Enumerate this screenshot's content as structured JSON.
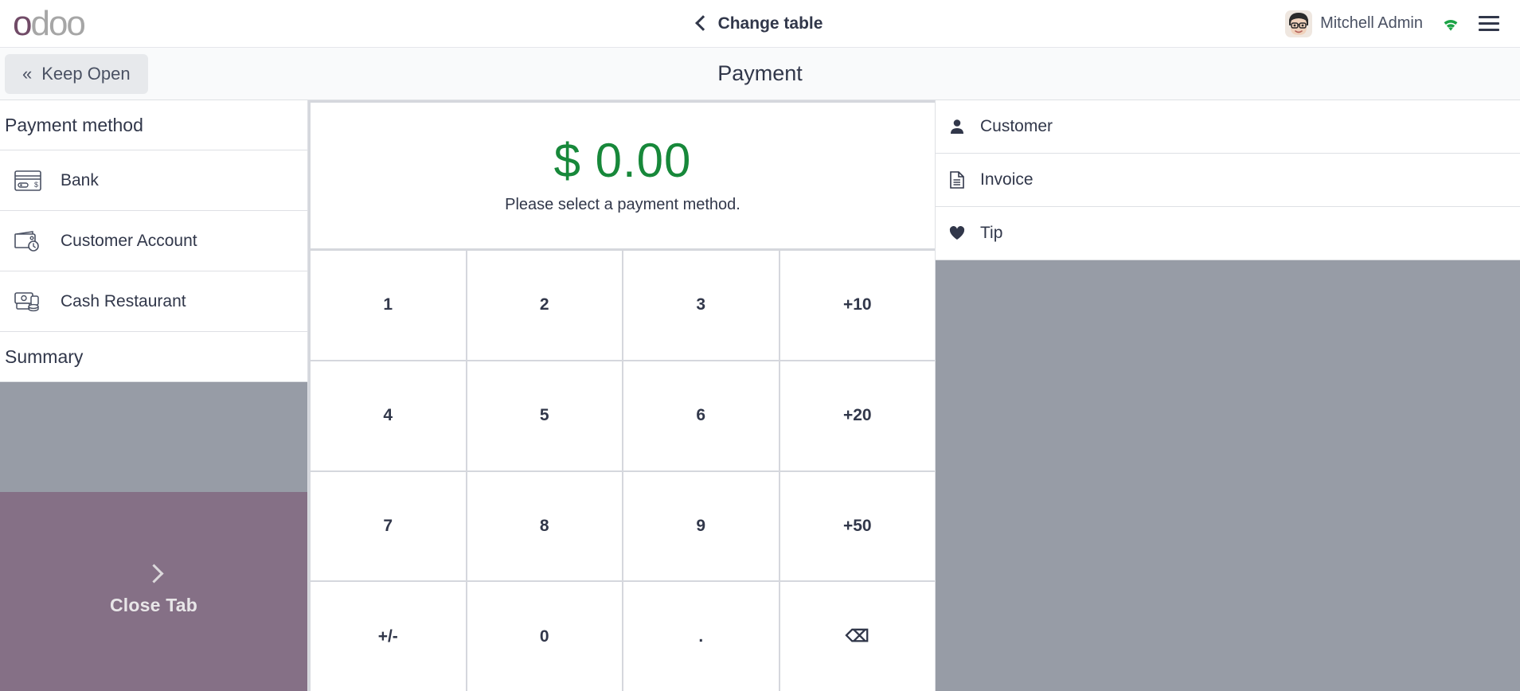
{
  "header": {
    "logo_text": "odoo",
    "logo_first_letter": "o",
    "logo_rest": "doo",
    "brand_purple": "#714b67",
    "brand_gray": "#a6a6a6",
    "back_label": "Change table",
    "back_icon": "chevron-left-icon",
    "user_name": "Mitchell Admin",
    "avatar_icon": "user-avatar",
    "wifi_icon": "wifi-icon",
    "wifi_color": "#1ba345",
    "menu_icon": "hamburger-menu-icon"
  },
  "subheader": {
    "keep_open_label": "Keep Open",
    "keep_open_icon": "double-chevron-left-icon",
    "page_title": "Payment"
  },
  "left_panel": {
    "payment_method_header": "Payment method",
    "payment_methods": [
      {
        "label": "Bank",
        "icon": "credit-card-icon"
      },
      {
        "label": "Customer Account",
        "icon": "wallet-clock-icon"
      },
      {
        "label": "Cash Restaurant",
        "icon": "cash-money-icon"
      }
    ],
    "summary_header": "Summary",
    "close_tab_label": "Close Tab",
    "close_tab_icon": "chevron-right-icon",
    "close_tab_color": "#857086",
    "summary_fill_color": "#979ca6"
  },
  "center_panel": {
    "amount": "$ 0.00",
    "amount_color": "#17883a",
    "hint": "Please select a payment method.",
    "numpad": [
      {
        "label": "1",
        "name": "numpad-key-1"
      },
      {
        "label": "2",
        "name": "numpad-key-2"
      },
      {
        "label": "3",
        "name": "numpad-key-3"
      },
      {
        "label": "+10",
        "name": "numpad-key-plus-10"
      },
      {
        "label": "4",
        "name": "numpad-key-4"
      },
      {
        "label": "5",
        "name": "numpad-key-5"
      },
      {
        "label": "6",
        "name": "numpad-key-6"
      },
      {
        "label": "+20",
        "name": "numpad-key-plus-20"
      },
      {
        "label": "7",
        "name": "numpad-key-7"
      },
      {
        "label": "8",
        "name": "numpad-key-8"
      },
      {
        "label": "9",
        "name": "numpad-key-9"
      },
      {
        "label": "+50",
        "name": "numpad-key-plus-50"
      },
      {
        "label": "+/-",
        "name": "numpad-key-sign"
      },
      {
        "label": "0",
        "name": "numpad-key-0"
      },
      {
        "label": ".",
        "name": "numpad-key-decimal"
      },
      {
        "label": "⌫",
        "name": "numpad-key-backspace"
      }
    ]
  },
  "right_panel": {
    "actions": [
      {
        "label": "Customer",
        "icon": "person-icon"
      },
      {
        "label": "Invoice",
        "icon": "document-icon"
      },
      {
        "label": "Tip",
        "icon": "heart-icon"
      }
    ],
    "fill_color": "#979ca6"
  }
}
